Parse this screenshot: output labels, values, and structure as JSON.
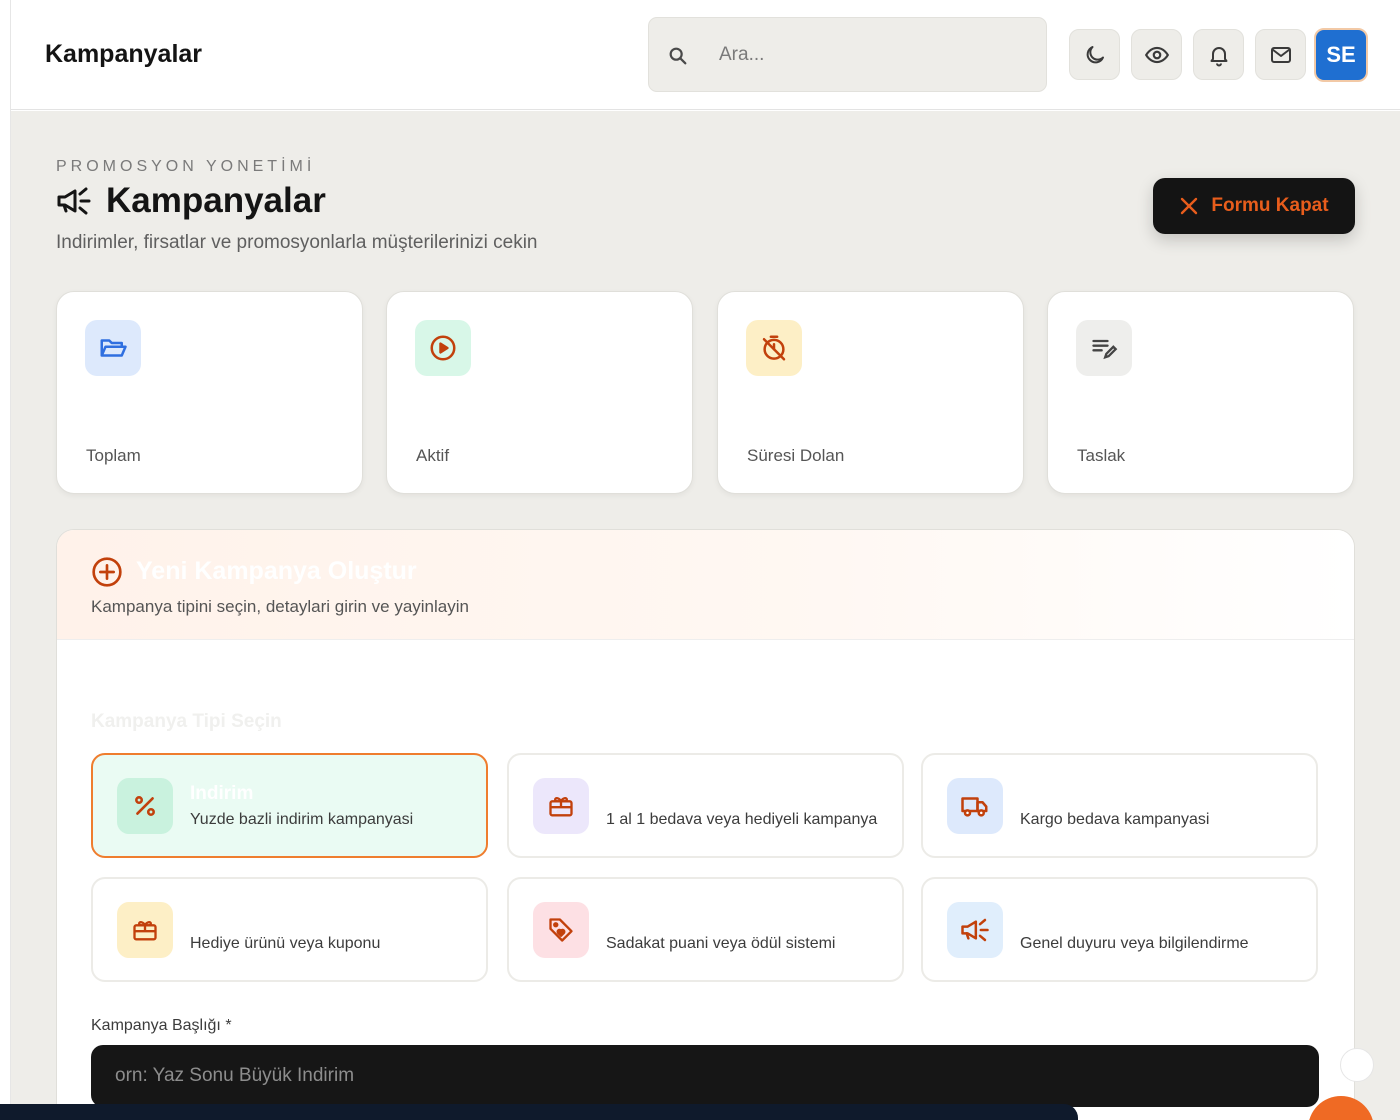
{
  "header": {
    "title": "Kampanyalar",
    "search_placeholder": "Ara...",
    "avatar_initials": "SE"
  },
  "page": {
    "kicker": "PROMOSYON YONETİMİ",
    "title": "Kampanyalar",
    "subtitle": "Indirimler, firsatlar ve promosyonlarla müşterilerinizi cekin",
    "close_form_label": "Formu Kapat"
  },
  "stats": [
    {
      "label": "Toplam",
      "icon": "folder-open-icon",
      "color": "#2f6fe0"
    },
    {
      "label": "Aktif",
      "icon": "play-circle-icon",
      "color": "#c2410c"
    },
    {
      "label": "Süresi Dolan",
      "icon": "timer-off-icon",
      "color": "#c2410c"
    },
    {
      "label": "Taslak",
      "icon": "edit-note-icon",
      "color": "#444444"
    }
  ],
  "form": {
    "title": "Yeni Kampanya Oluştur",
    "subtitle": "Kampanya tipini seçin, detaylari girin ve yayinlayin",
    "section_label": "Kampanya Tipi Seçin",
    "types": [
      {
        "title": "Indirim",
        "description": "Yuzde bazli indirim kampanyasi",
        "icon": "percent-icon",
        "selected": true
      },
      {
        "title": "",
        "description": "1 al 1 bedava veya hediyeli kampanya",
        "icon": "gift-card-icon",
        "selected": false
      },
      {
        "title": "",
        "description": "Kargo bedava kampanyasi",
        "icon": "truck-icon",
        "selected": false
      },
      {
        "title": "",
        "description": "Hediye ürünü veya kuponu",
        "icon": "gift-icon",
        "selected": false
      },
      {
        "title": "",
        "description": "Sadakat puani veya ödül sistemi",
        "icon": "loyalty-tag-icon",
        "selected": false
      },
      {
        "title": "",
        "description": "Genel duyuru veya bilgilendirme",
        "icon": "campaign-icon",
        "selected": false
      }
    ],
    "title_field": {
      "label": "Kampanya Başlığı",
      "required_mark": "*",
      "placeholder": "orn: Yaz Sonu Büyük Indirim",
      "value": ""
    }
  },
  "colors": {
    "accent": "#e85d1c",
    "icon_orange": "#c2410c",
    "avatar_bg": "#1f6fd1"
  }
}
